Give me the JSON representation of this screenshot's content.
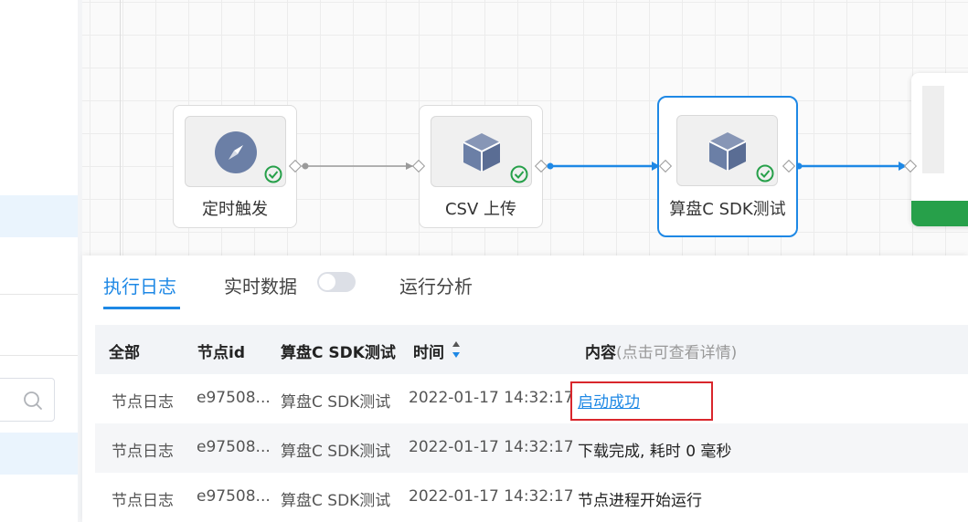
{
  "nodes": [
    {
      "label": "定时触发",
      "icon": "compass-icon",
      "status": "success"
    },
    {
      "label": "CSV 上传",
      "icon": "cube-icon",
      "status": "success"
    },
    {
      "label": "算盘C SDK测试",
      "icon": "cube-icon",
      "status": "success",
      "selected": true
    }
  ],
  "tabs": [
    {
      "label": "执行日志",
      "active": true
    },
    {
      "label": "实时数据",
      "toggle": false
    },
    {
      "label": "运行分析"
    }
  ],
  "table": {
    "headers": {
      "type": "全部",
      "node_id": "节点id",
      "node_name": "算盘C SDK测试",
      "time": "时间",
      "content": "内容",
      "content_hint": "(点击可查看详情)"
    },
    "rows": [
      {
        "type": "节点日志",
        "node_id": "e97508...",
        "node_name": "算盘C SDK测试",
        "time": "2022-01-17 14:32:17",
        "content": "启动成功"
      },
      {
        "type": "节点日志",
        "node_id": "e97508...",
        "node_name": "算盘C SDK测试",
        "time": "2022-01-17 14:32:17",
        "content": "下载完成, 耗时 0 毫秒"
      },
      {
        "type": "节点日志",
        "node_id": "e97508...",
        "node_name": "算盘C SDK测试",
        "time": "2022-01-17 14:32:17",
        "content": "节点进程开始运行"
      }
    ]
  },
  "colors": {
    "accent": "#1e88e5",
    "success": "#27a04a",
    "highlight_box": "#d9262c",
    "icon_fill": "#6b7fa6"
  }
}
